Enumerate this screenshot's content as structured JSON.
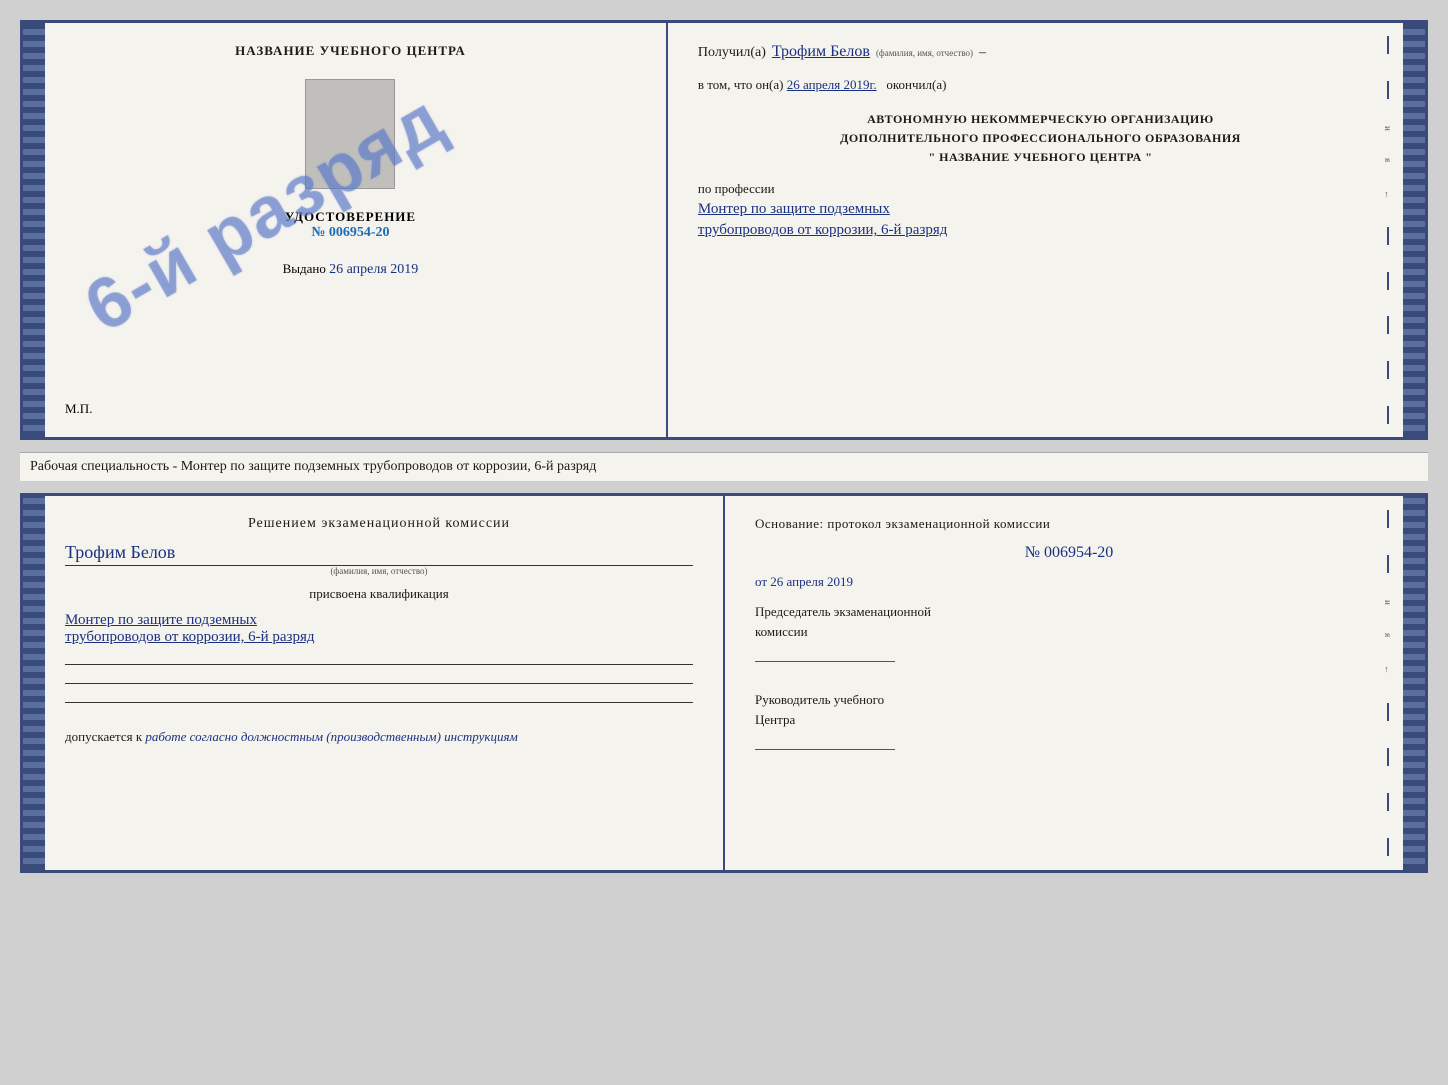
{
  "top_cert": {
    "left": {
      "title": "НАЗВАНИЕ УЧЕБНОГО ЦЕНТРА",
      "stamp_text": "6-й разряд",
      "udostoverenie_label": "УДОСТОВЕРЕНИЕ",
      "number": "№ 006954-20",
      "vydano_label": "Выдано",
      "vydano_date": "26 апреля 2019",
      "mp_label": "М.П."
    },
    "right": {
      "poluchil_label": "Получил(а)",
      "recipient_name": "Трофим Белов",
      "fio_label": "(фамилия, имя, отчество)",
      "dash1": "–",
      "vtom_label": "в том, что он(а)",
      "vtom_date": "26 апреля 2019г.",
      "okonchil_label": "окончил(а)",
      "org_line1": "АВТОНОМНУЮ НЕКОММЕРЧЕСКУЮ ОРГАНИЗАЦИЮ",
      "org_line2": "ДОПОЛНИТЕЛЬНОГО ПРОФЕССИОНАЛЬНОГО ОБРАЗОВАНИЯ",
      "org_name": "\" НАЗВАНИЕ УЧЕБНОГО ЦЕНТРА \"",
      "po_professii": "по профессии",
      "profession_line1": "Монтер по защите подземных",
      "profession_line2": "трубопроводов от коррозии, 6-й разряд"
    }
  },
  "specialty_label": "Рабочая специальность - Монтер по защите подземных трубопроводов от коррозии, 6-й разряд",
  "bottom_cert": {
    "left": {
      "resheniem_label": "Решением экзаменационной комиссии",
      "name_handwritten": "Трофим Белов",
      "fio_label": "(фамилия, имя, отчество)",
      "prisvoena_label": "присвоена квалификация",
      "qual_line1": "Монтер по защите подземных",
      "qual_line2": "трубопроводов от коррозии, 6-й разряд",
      "dopusk_label": "допускается к",
      "dopusk_text": "работе согласно должностным (производственным) инструкциям"
    },
    "right": {
      "osnov_label": "Основание: протокол экзаменационной комиссии",
      "number": "№ 006954-20",
      "date_prefix": "от",
      "date_value": "26 апреля 2019",
      "chairman_line1": "Председатель экзаменационной",
      "chairman_line2": "комиссии",
      "rukovod_line1": "Руководитель учебного",
      "rukovod_line2": "Центра"
    }
  },
  "deco": {
    "and_label": "и",
    "ya_label": "я",
    "left_arrow": "←",
    "dash": "–"
  }
}
